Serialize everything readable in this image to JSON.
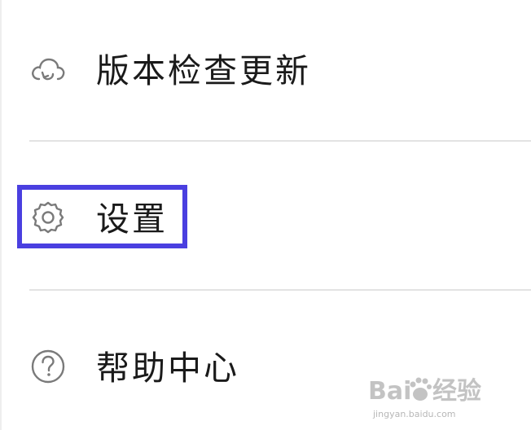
{
  "menu": {
    "items": [
      {
        "label": "版本检查更新",
        "icon": "cloud-refresh-icon"
      },
      {
        "label": "设置",
        "icon": "gear-icon"
      },
      {
        "label": "帮助中心",
        "icon": "help-circle-icon"
      }
    ]
  },
  "annotation": {
    "highlight_target": "设置",
    "color": "#4a3fe0"
  },
  "watermark": {
    "brand": "Baidu 经验",
    "url": "jingyan.baidu.com"
  }
}
